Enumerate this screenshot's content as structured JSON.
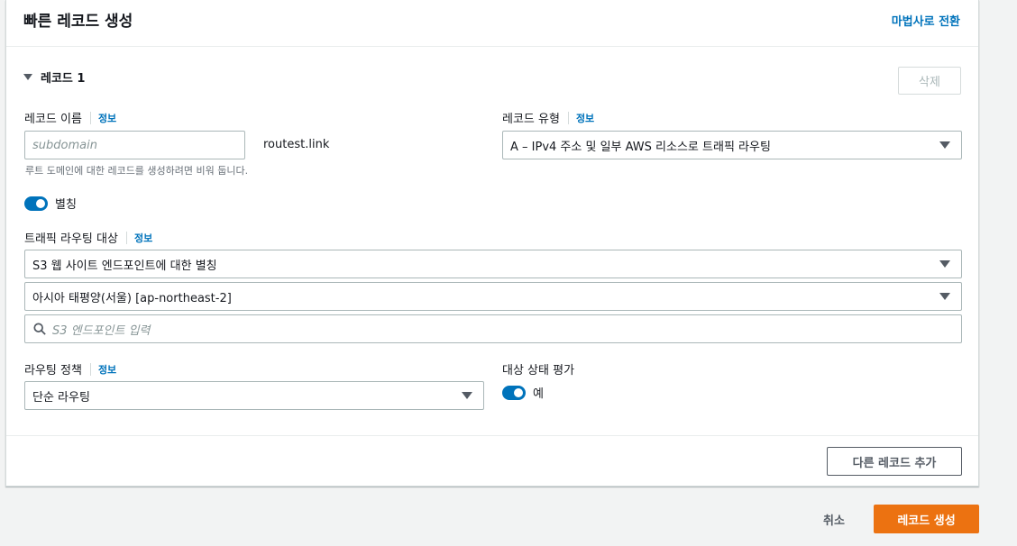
{
  "header": {
    "title": "빠른 레코드 생성",
    "wizard_link": "마법사로 전환"
  },
  "record": {
    "title": "레코드 1",
    "delete_label": "삭제",
    "name": {
      "label": "레코드 이름",
      "info": "정보",
      "placeholder": "subdomain",
      "suffix": "routest.link",
      "help": "루트 도메인에 대한 레코드를 생성하려면 비워 둡니다."
    },
    "type": {
      "label": "레코드 유형",
      "info": "정보",
      "value": "A – IPv4 주소 및 일부 AWS 리소스로 트래픽 라우팅"
    },
    "alias": {
      "label": "별칭",
      "on": true
    },
    "target": {
      "label": "트래픽 라우팅 대상",
      "info": "정보",
      "endpoint_type": "S3 웹 사이트 엔드포인트에 대한 별칭",
      "region": "아시아 태평양(서울) [ap-northeast-2]",
      "search_placeholder": "S3 엔드포인트 입력"
    },
    "policy": {
      "label": "라우팅 정책",
      "info": "정보",
      "value": "단순 라우팅"
    },
    "health": {
      "label": "대상 상태 평가",
      "toggle_label": "예",
      "on": true
    }
  },
  "add_record_label": "다른 레코드 추가",
  "footer": {
    "cancel_label": "취소",
    "create_label": "레코드 생성"
  },
  "colors": {
    "accent": "#0073bb",
    "primary_button": "#ec7211"
  }
}
